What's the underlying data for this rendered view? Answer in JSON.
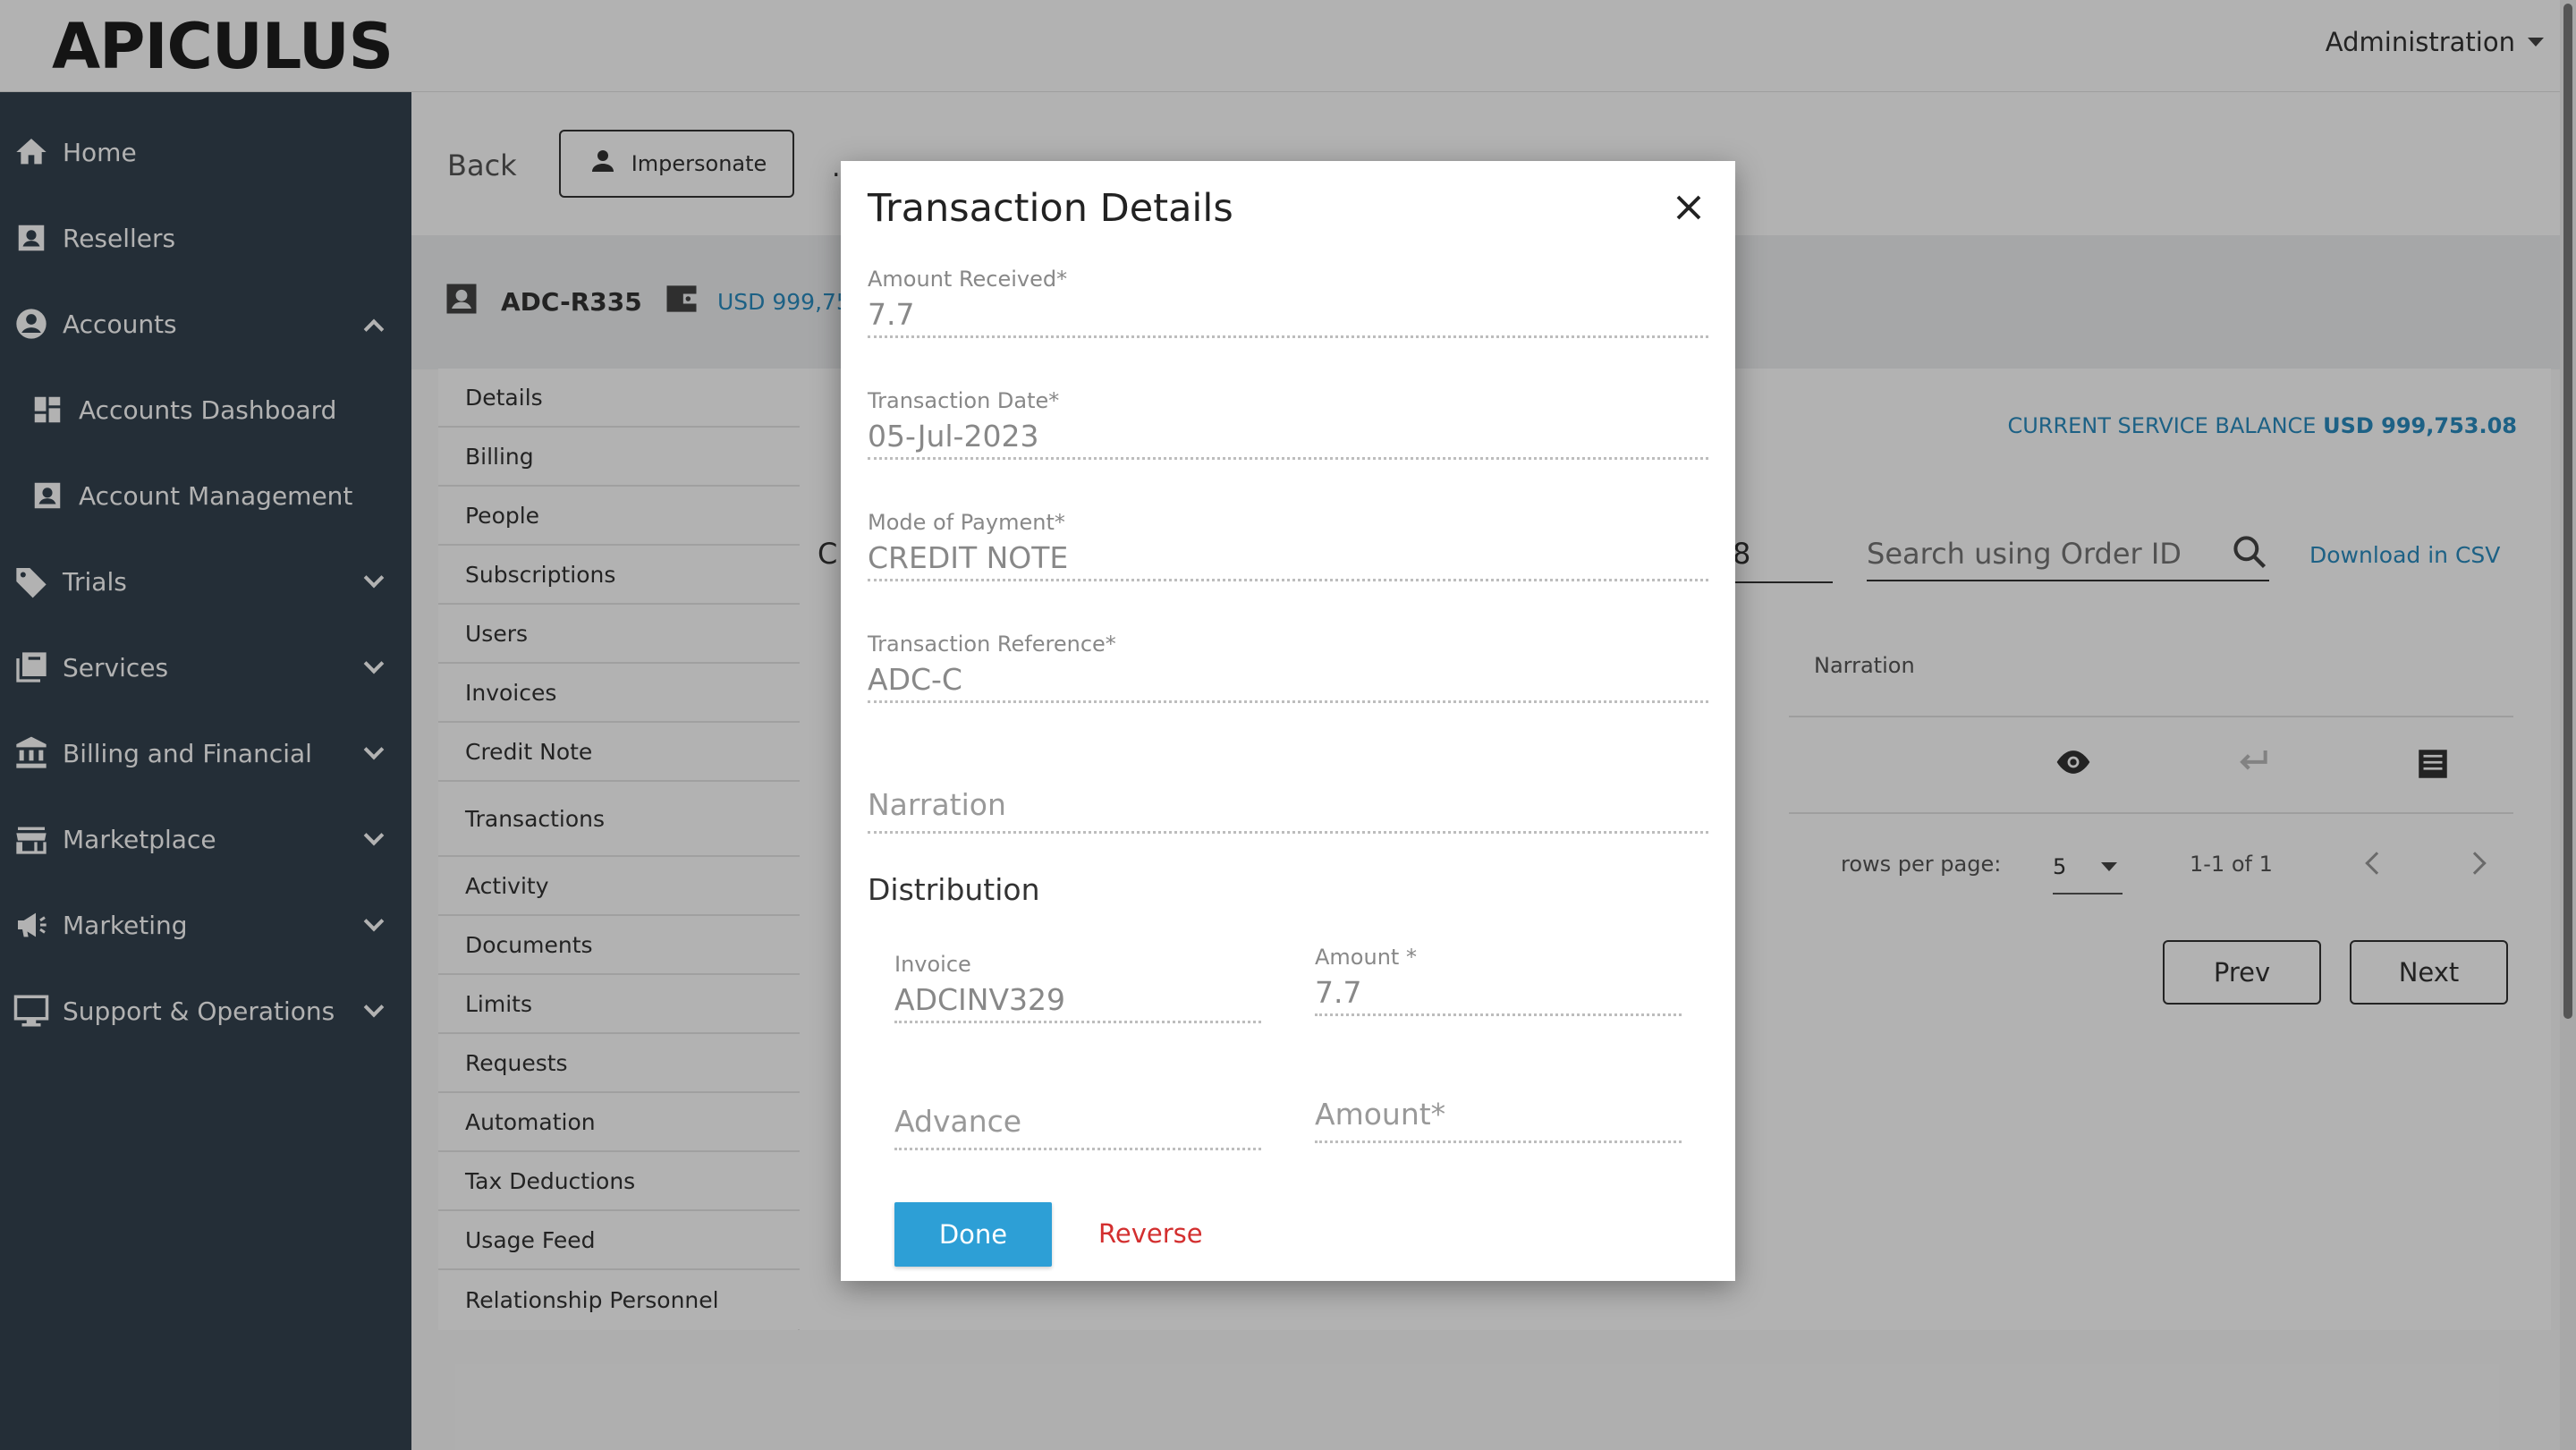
{
  "app": {
    "brand": "APICULUS",
    "admin_menu": "Administration"
  },
  "sidebar": {
    "items": [
      {
        "label": "Home",
        "icon": "home-icon"
      },
      {
        "label": "Resellers",
        "icon": "person-badge-icon"
      },
      {
        "label": "Accounts",
        "icon": "account-circle-icon",
        "expanded": true
      },
      {
        "label": "Accounts Dashboard",
        "icon": "dashboard-icon"
      },
      {
        "label": "Account Management",
        "icon": "person-badge-icon"
      },
      {
        "label": "Trials",
        "icon": "tag-icon"
      },
      {
        "label": "Services",
        "icon": "library-icon"
      },
      {
        "label": "Billing and Financial",
        "icon": "bank-icon"
      },
      {
        "label": "Marketplace",
        "icon": "store-icon"
      },
      {
        "label": "Marketing",
        "icon": "megaphone-icon"
      },
      {
        "label": "Support & Operations",
        "icon": "monitor-icon"
      }
    ]
  },
  "actionbar": {
    "back": "Back",
    "impersonate": "Impersonate",
    "more": "..."
  },
  "account": {
    "id": "ADC-R335",
    "wallet_partial": "USD 999,75"
  },
  "tabs": [
    "Details",
    "Billing",
    "People",
    "Subscriptions",
    "Users",
    "Invoices",
    "Credit Note",
    "Transactions",
    "Activity",
    "Documents",
    "Limits",
    "Requests",
    "Automation",
    "Tax Deductions",
    "Usage Feed",
    "Relationship Personnel"
  ],
  "main": {
    "balance_label": "CURRENT SERVICE BALANCE",
    "balance_value": "USD 999,753.08",
    "partial_left": "C",
    "partial_field": "8",
    "search_placeholder": "Search using Order ID",
    "download_csv": "Download in CSV",
    "col_narration": "Narration",
    "rows_per_page_label": "rows per page:",
    "rows_per_page_value": "5",
    "page_range": "1-1 of 1",
    "prev": "Prev",
    "next": "Next"
  },
  "modal": {
    "title": "Transaction Details",
    "fields": {
      "amount_received": {
        "label": "Amount Received*",
        "value": "7.7"
      },
      "transaction_date": {
        "label": "Transaction Date*",
        "value": "05-Jul-2023"
      },
      "mode_of_payment": {
        "label": "Mode of Payment*",
        "value": "CREDIT NOTE"
      },
      "transaction_reference": {
        "label": "Transaction Reference*",
        "value": "ADC-C"
      },
      "narration_placeholder": "Narration"
    },
    "distribution": {
      "title": "Distribution",
      "invoice": {
        "label": "Invoice",
        "value": "ADCINV329"
      },
      "amount": {
        "label": "Amount *",
        "value": "7.7"
      },
      "advance_placeholder": "Advance",
      "advance_amount_placeholder": "Amount*"
    },
    "done": "Done",
    "reverse": "Reverse"
  },
  "colors": {
    "sidebar_bg": "#34424f",
    "accent_blue": "#2d9fd6",
    "link_blue": "#2a8bbf",
    "danger_red": "#d32f2f"
  }
}
